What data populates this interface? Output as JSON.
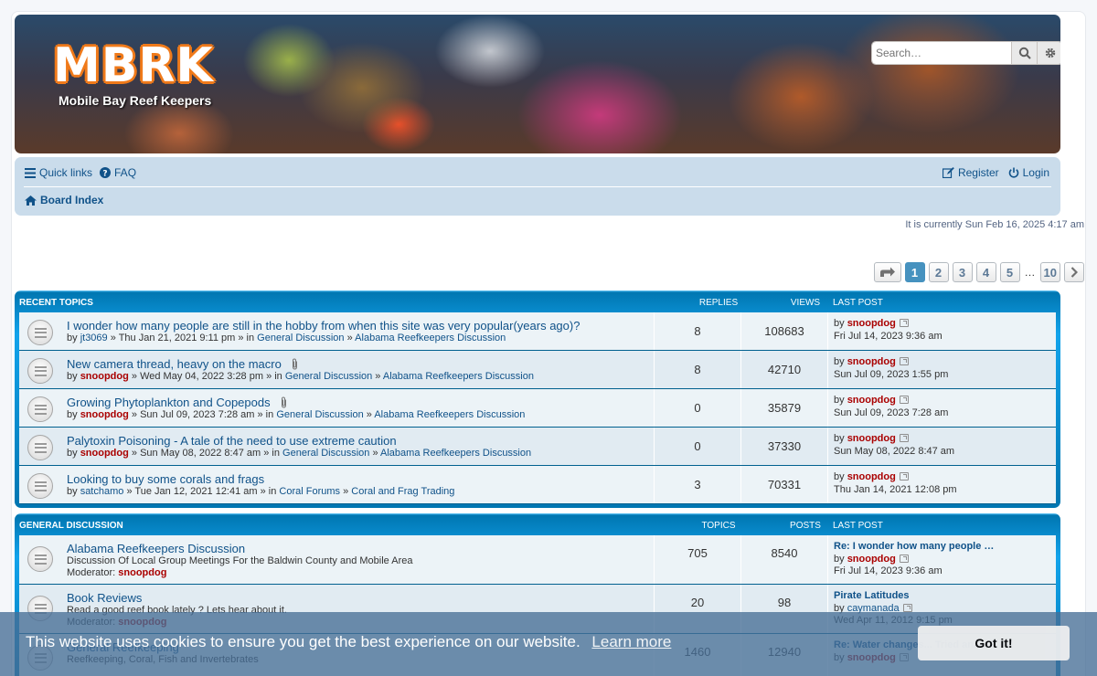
{
  "header": {
    "logo_text": "MBRK",
    "logo_sub": "Mobile Bay Reef Keepers",
    "search_placeholder": "Search…"
  },
  "nav": {
    "quick_links": "Quick links",
    "faq": "FAQ",
    "register": "Register",
    "login": "Login",
    "board_index": "Board Index"
  },
  "current_time": "It is currently Sun Feb 16, 2025 4:17 am",
  "pagination": {
    "pages": [
      "1",
      "2",
      "3",
      "4",
      "5"
    ],
    "ellipsis": "…",
    "last": "10",
    "active": "1"
  },
  "recent": {
    "heading": "Recent Topics",
    "col_replies": "Replies",
    "col_views": "Views",
    "col_last": "Last Post",
    "rows": [
      {
        "title": "I wonder how many people are still in the hobby from when this site was very popular(years ago)?",
        "by": "by",
        "author": "jt3069",
        "author_red": false,
        "date": "» Thu Jan 21, 2021 9:11 pm » in",
        "forum": "General Discussion",
        "sub": "Alabama Reefkeepers Discussion",
        "replies": "8",
        "views": "108683",
        "lp_user": "snoopdog",
        "lp_date": "Fri Jul 14, 2023 9:36 am",
        "attach": false
      },
      {
        "title": "New camera thread, heavy on the macro",
        "by": "by",
        "author": "snoopdog",
        "author_red": true,
        "date": "» Wed May 04, 2022 3:28 pm » in",
        "forum": "General Discussion",
        "sub": "Alabama Reefkeepers Discussion",
        "replies": "8",
        "views": "42710",
        "lp_user": "snoopdog",
        "lp_date": "Sun Jul 09, 2023 1:55 pm",
        "attach": true
      },
      {
        "title": "Growing Phytoplankton and Copepods",
        "by": "by",
        "author": "snoopdog",
        "author_red": true,
        "date": "» Sun Jul 09, 2023 7:28 am » in",
        "forum": "General Discussion",
        "sub": "Alabama Reefkeepers Discussion",
        "replies": "0",
        "views": "35879",
        "lp_user": "snoopdog",
        "lp_date": "Sun Jul 09, 2023 7:28 am",
        "attach": true
      },
      {
        "title": "Palytoxin Poisoning - A tale of the need to use extreme caution",
        "by": "by",
        "author": "snoopdog",
        "author_red": true,
        "date": "» Sun May 08, 2022 8:47 am » in",
        "forum": "General Discussion",
        "sub": "Alabama Reefkeepers Discussion",
        "replies": "0",
        "views": "37330",
        "lp_user": "snoopdog",
        "lp_date": "Sun May 08, 2022 8:47 am",
        "attach": false
      },
      {
        "title": "Looking to buy some corals and frags",
        "by": "by",
        "author": "satchamo",
        "author_red": false,
        "date": "» Tue Jan 12, 2021 12:41 am » in",
        "forum": "Coral Forums",
        "sub": "Coral and Frag Trading",
        "replies": "3",
        "views": "70331",
        "lp_user": "snoopdog",
        "lp_date": "Thu Jan 14, 2021 12:08 pm",
        "attach": false
      }
    ]
  },
  "general": {
    "heading": "General Discussion",
    "col_topics": "Topics",
    "col_posts": "Posts",
    "col_last": "Last Post",
    "rows": [
      {
        "title": "Alabama Reefkeepers Discussion",
        "desc": "Discussion Of Local Group Meetings For the Baldwin County and Mobile Area",
        "mod_label": "Moderator:",
        "mod": "snoopdog",
        "topics": "705",
        "posts": "8540",
        "lp_title": "Re: I wonder how many people …",
        "lp_by": "by",
        "lp_user": "snoopdog",
        "lp_user_red": true,
        "lp_date": "Fri Jul 14, 2023 9:36 am"
      },
      {
        "title": "Book Reviews",
        "desc": "Read a good reef book lately ? Lets hear about it.",
        "mod_label": "Moderator:",
        "mod": "snoopdog",
        "topics": "20",
        "posts": "98",
        "lp_title": "Pirate Latitudes",
        "lp_by": "by",
        "lp_user": "caymanada",
        "lp_user_red": false,
        "lp_date": "Wed Apr 11, 2012 9:15 pm"
      },
      {
        "title": "General Reefkeeping",
        "desc": "Reefkeeping, Coral, Fish and Invertebrates",
        "mod_label": "",
        "mod": "",
        "topics": "1460",
        "posts": "12940",
        "lp_title": "Re: Water changes... Tried an...",
        "lp_by": "by",
        "lp_user": "snoopdog",
        "lp_user_red": true,
        "lp_date": ""
      }
    ]
  },
  "cookie": {
    "message": "This website uses cookies to ensure you get the best experience on our website.",
    "learn_more": "Learn more",
    "got_it": "Got it!"
  },
  "colors": {
    "link": "#105289",
    "accent": "#0076b1",
    "username_red": "#aa0000",
    "navbar_bg": "#cadceb"
  }
}
